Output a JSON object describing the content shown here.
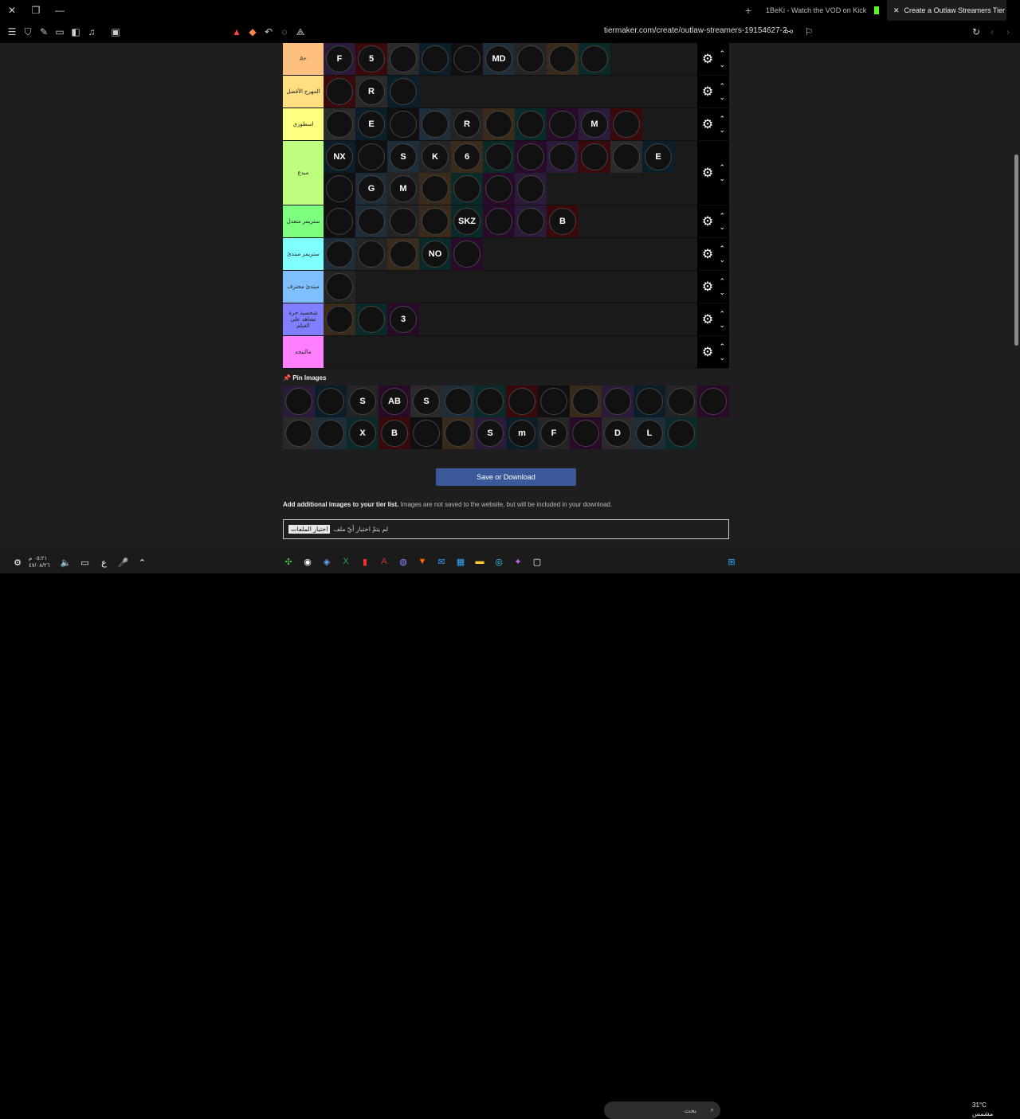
{
  "window": {
    "tabs": [
      {
        "label": "1BeKi - Watch the VOD on Kick",
        "active": false
      },
      {
        "label": "Create a Outlaw Streamers Tier L",
        "active": true
      }
    ],
    "url": "tiermaker.com/create/outlaw-streamers-19154627-2"
  },
  "tiers": [
    {
      "label": "A+",
      "color": "#ffbf7f",
      "items": [
        "F",
        "5",
        "",
        "",
        "",
        "MD",
        "",
        "",
        ""
      ]
    },
    {
      "label": "المهرج الأفضل",
      "color": "#ffdf7f",
      "items": [
        "",
        "R",
        ""
      ]
    },
    {
      "label": "اسطوري",
      "color": "#ffff7f",
      "items": [
        "",
        "E",
        "",
        "",
        "R",
        "",
        "",
        "",
        "M",
        ""
      ]
    },
    {
      "label": "مبدع",
      "color": "#bfff7f",
      "items": [
        "NX",
        "",
        "S",
        "K",
        "6",
        "",
        "",
        "",
        "",
        "",
        "E",
        "",
        "G",
        "M",
        "",
        "",
        "",
        ""
      ]
    },
    {
      "label": "ستريمر متعدل",
      "color": "#7fff7f",
      "items": [
        "",
        "",
        "",
        "",
        "SKZ",
        "",
        "",
        "B"
      ]
    },
    {
      "label": "ستريمر مبتدئ",
      "color": "#7fffff",
      "items": [
        "",
        "",
        "",
        "NO",
        ""
      ]
    },
    {
      "label": "مبتدئ محترف",
      "color": "#7fbfff",
      "items": [
        ""
      ]
    },
    {
      "label": "شخصية حرة تشاهد على الفيلم",
      "color": "#7f7fff",
      "items": [
        "",
        "",
        "3"
      ]
    },
    {
      "label": "مالتيجه",
      "color": "#ff7fff",
      "items": []
    }
  ],
  "pin": {
    "title": "Pin Images",
    "items": [
      "",
      "",
      "S",
      "AB",
      "S",
      "",
      "",
      "",
      "",
      "",
      "",
      "",
      "",
      "",
      "",
      "",
      "X",
      "B",
      "",
      "",
      "S",
      "m",
      "F",
      "",
      "D",
      "L",
      ""
    ]
  },
  "save_label": "Save or Download",
  "add_text_bold": "Add additional images to your tier list.",
  "add_text_rest": " Images are not saved to the website, but will be included in your download.",
  "file_btn": "اختيار الملفات",
  "file_status": "لم يتمّ اختيار أيّ ملف",
  "taskbar": {
    "clock": "٠٥:٢١ م",
    "date": "٤٧/٠٨/٢٦",
    "search_placeholder": "بحث",
    "temp": "31°C",
    "weather": "مشمس",
    "lang": "ع"
  }
}
